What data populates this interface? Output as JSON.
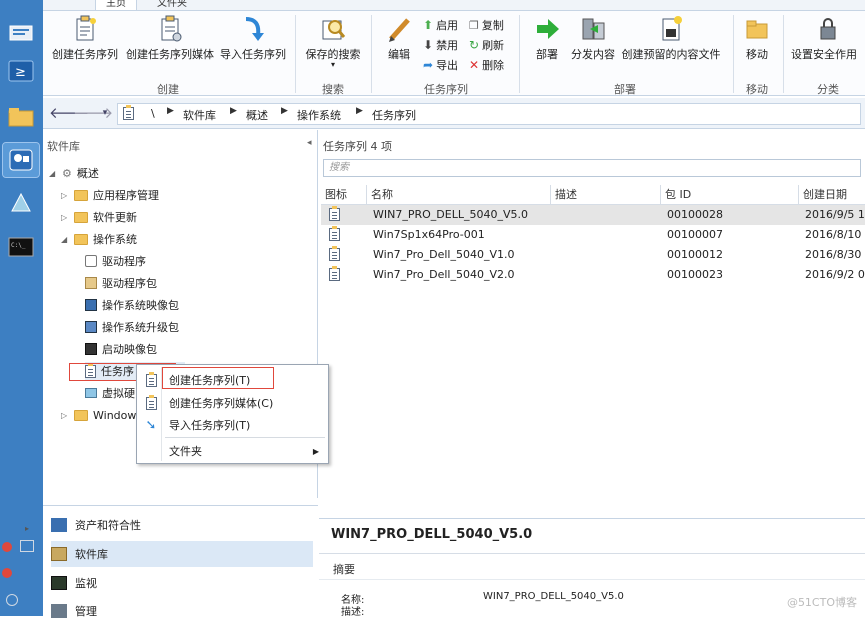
{
  "tabs": [
    {
      "label": "主页"
    },
    {
      "label": "文件夹"
    }
  ],
  "ribbon": {
    "create_task_sequence": "创建任务序列",
    "create_ts_media": "创建任务序列媒体",
    "import_task_sequence": "导入任务序列",
    "saved_searches": "保存的搜索",
    "edit": "编辑",
    "enable": "启用",
    "disable": "禁用",
    "export": "导出",
    "copy": "复制",
    "refresh": "刷新",
    "delete": "删除",
    "deploy": "部署",
    "distribute_content": "分发内容",
    "create_prestaged": "创建预留的内容文件",
    "move": "移动",
    "set_security_scope": "设置安全作用",
    "groups": {
      "create": "创建",
      "search": "搜索",
      "task_sequence": "任务序列",
      "deployment": "部署",
      "move": "移动",
      "classify": "分类"
    }
  },
  "address": {
    "root": "\\",
    "crumbs": [
      "软件库",
      "概述",
      "操作系统",
      "任务序列"
    ]
  },
  "tree": {
    "title": "软件库",
    "items": [
      {
        "label": "概述"
      },
      {
        "label": "应用程序管理"
      },
      {
        "label": "软件更新"
      },
      {
        "label": "操作系统"
      },
      {
        "label": "驱动程序"
      },
      {
        "label": "驱动程序包"
      },
      {
        "label": "操作系统映像包"
      },
      {
        "label": "操作系统升级包"
      },
      {
        "label": "启动映像包"
      },
      {
        "label": "任务序"
      },
      {
        "label": "虚拟硬"
      },
      {
        "label": "Windows"
      }
    ]
  },
  "wunderbar": [
    {
      "label": "资产和符合性"
    },
    {
      "label": "软件库"
    },
    {
      "label": "监视"
    },
    {
      "label": "管理"
    }
  ],
  "list": {
    "title": "任务序列 4 项",
    "search_placeholder": "搜索",
    "columns": [
      "图标",
      "名称",
      "描述",
      "包 ID",
      "创建日期"
    ],
    "rows": [
      {
        "name": "WIN7_PRO_DELL_5040_V5.0",
        "desc": "",
        "pkg": "00100028",
        "date": "2016/9/5 1"
      },
      {
        "name": "Win7Sp1x64Pro-001",
        "desc": "",
        "pkg": "00100007",
        "date": "2016/8/10"
      },
      {
        "name": "Win7_Pro_Dell_5040_V1.0",
        "desc": "",
        "pkg": "00100012",
        "date": "2016/8/30"
      },
      {
        "name": "Win7_Pro_Dell_5040_V2.0",
        "desc": "",
        "pkg": "00100023",
        "date": "2016/9/2 0"
      }
    ]
  },
  "details": {
    "title": "WIN7_PRO_DELL_5040_V5.0",
    "section": "摘要",
    "name_label": "名称:",
    "name_value": "WIN7_PRO_DELL_5040_V5.0",
    "desc_label": "描述:"
  },
  "context_menu": {
    "items": [
      {
        "label": "创建任务序列(T)"
      },
      {
        "label": "创建任务序列媒体(C)"
      },
      {
        "label": "导入任务序列(T)"
      },
      {
        "label": "文件夹"
      }
    ]
  },
  "watermark": "@51CTO博客",
  "colors": {
    "accent": "#3d7fc2",
    "highlight": "#e0483c"
  }
}
